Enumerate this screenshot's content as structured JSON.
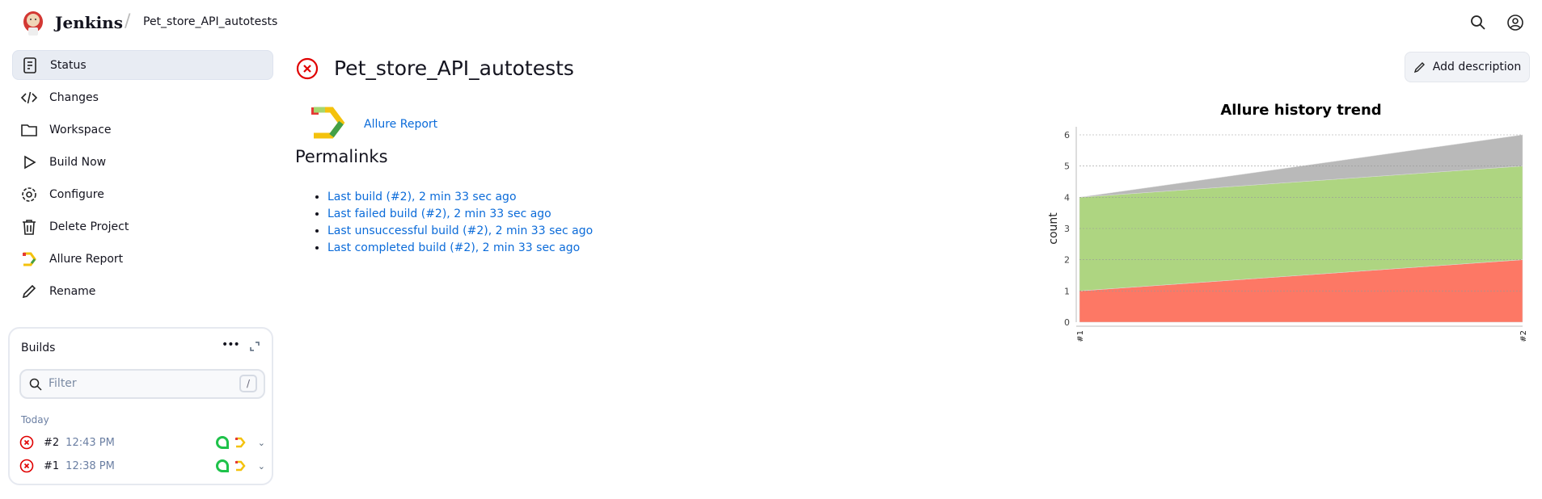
{
  "header": {
    "brand": "Jenkins",
    "breadcrumb": "Pet_store_API_autotests",
    "icons": [
      "search-icon",
      "user-icon"
    ]
  },
  "sidebar": {
    "items": [
      {
        "label": "Status",
        "icon": "document-icon"
      },
      {
        "label": "Changes",
        "icon": "code-icon"
      },
      {
        "label": "Workspace",
        "icon": "folder-icon"
      },
      {
        "label": "Build Now",
        "icon": "play-icon"
      },
      {
        "label": "Configure",
        "icon": "gear-icon"
      },
      {
        "label": "Delete Project",
        "icon": "trash-icon"
      },
      {
        "label": "Allure Report",
        "icon": "allure-icon"
      },
      {
        "label": "Rename",
        "icon": "pencil-icon"
      }
    ]
  },
  "builds": {
    "title": "Builds",
    "filter_placeholder": "Filter",
    "shortcut": "/",
    "group": "Today",
    "items": [
      {
        "number": "#2",
        "time": "12:43 PM",
        "status": "failed"
      },
      {
        "number": "#1",
        "time": "12:38 PM",
        "status": "failed"
      }
    ]
  },
  "main": {
    "title": "Pet_store_API_autotests",
    "status": "failed",
    "add_description": "Add description",
    "allure_link": "Allure Report",
    "permalinks_title": "Permalinks",
    "permalinks": [
      "Last build (#2), 2 min 33 sec ago",
      "Last failed build (#2), 2 min 33 sec ago",
      "Last unsuccessful build (#2), 2 min 33 sec ago",
      "Last completed build (#2), 2 min 33 sec ago"
    ]
  },
  "chart_data": {
    "type": "area",
    "stacked": true,
    "title": "Allure history trend",
    "xlabel": "",
    "ylabel": "count",
    "categories": [
      "#1",
      "#2"
    ],
    "ylim": [
      0,
      6
    ],
    "yticks": [
      0,
      1,
      2,
      3,
      4,
      5,
      6
    ],
    "grid": true,
    "series": [
      {
        "values": [
          1,
          2
        ],
        "color": "#fd7865"
      },
      {
        "values": [
          3,
          3
        ],
        "color": "#aed581"
      },
      {
        "values": [
          0,
          1
        ],
        "color": "#b9b9b9"
      }
    ]
  },
  "colors": {
    "failed": "#e00000",
    "link": "#0b6bd9"
  }
}
